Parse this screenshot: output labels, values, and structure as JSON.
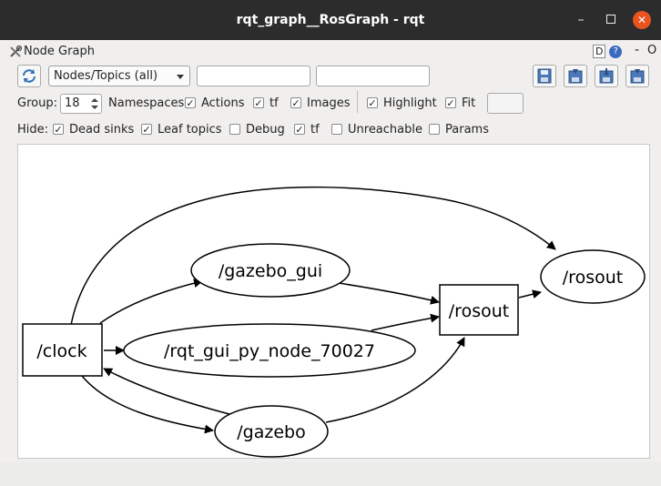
{
  "window": {
    "title": "rqt_graph__RosGraph - rqt",
    "minimize": "–",
    "close": "✕"
  },
  "plugin": {
    "title": "Node Graph",
    "help_d": "D",
    "help_q": "?",
    "dash": "-",
    "o": "O"
  },
  "toolbar": {
    "refresh_icon": "refresh-icon",
    "mode_selected": "Nodes/Topics (all)",
    "filter1_value": "",
    "filter2_value": "",
    "save_icons": [
      "save-icon",
      "load-icon",
      "export-icon"
    ]
  },
  "options_row": {
    "group_label": "Group:",
    "group_value": "18",
    "namespaces_label": "Namespaces",
    "actions_label": "Actions",
    "tf_label": "tf",
    "images_label": "Images",
    "highlight_label": "Highlight",
    "fit_label": "Fit",
    "checks": {
      "actions": true,
      "tf": true,
      "images": true,
      "highlight": true,
      "fit": true
    }
  },
  "hide_row": {
    "hide_label": "Hide:",
    "dead_sinks_label": "Dead sinks",
    "leaf_topics_label": "Leaf topics",
    "debug_label": "Debug",
    "tf_label": "tf",
    "unreachable_label": "Unreachable",
    "params_label": "Params",
    "checks": {
      "dead_sinks": true,
      "leaf_topics": true,
      "debug": false,
      "tf": true,
      "unreachable": false,
      "params": false
    }
  },
  "graph": {
    "nodes": {
      "clock": "/clock",
      "gazebo_gui": "/gazebo_gui",
      "rqt_gui": "/rqt_gui_py_node_70027",
      "rosout_box": "/rosout",
      "rosout_ellipse": "/rosout",
      "gazebo": "/gazebo"
    }
  }
}
